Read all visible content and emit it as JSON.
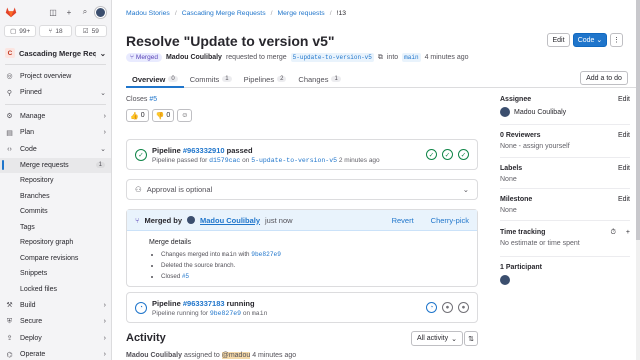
{
  "sidebar": {
    "counts": [
      {
        "icon": "issues-icon",
        "value": "99+"
      },
      {
        "icon": "merge-request-icon",
        "value": "18"
      },
      {
        "icon": "todo-icon",
        "value": "59"
      }
    ],
    "project_initial": "C",
    "project_name": "Cascading Merge Requ...",
    "items": [
      {
        "label": "Project overview",
        "icon": "overview-icon"
      },
      {
        "label": "Pinned",
        "icon": "pin-icon"
      },
      {
        "label": "Manage",
        "icon": "manage-icon"
      },
      {
        "label": "Plan",
        "icon": "plan-icon"
      },
      {
        "label": "Code",
        "icon": "code-icon"
      }
    ],
    "code_sub": [
      {
        "label": "Merge requests",
        "badge": "1"
      },
      {
        "label": "Repository"
      },
      {
        "label": "Branches"
      },
      {
        "label": "Commits"
      },
      {
        "label": "Tags"
      },
      {
        "label": "Repository graph"
      },
      {
        "label": "Compare revisions"
      },
      {
        "label": "Snippets"
      },
      {
        "label": "Locked files"
      }
    ],
    "bottom": [
      {
        "label": "Build",
        "icon": "build-icon"
      },
      {
        "label": "Secure",
        "icon": "secure-icon"
      },
      {
        "label": "Deploy",
        "icon": "deploy-icon"
      },
      {
        "label": "Operate",
        "icon": "operate-icon"
      }
    ]
  },
  "breadcrumbs": [
    "Madou Stories",
    "Cascading Merge Requests",
    "Merge requests",
    "!13"
  ],
  "title": "Resolve \"Update to version v5\"",
  "buttons": {
    "edit": "Edit",
    "code": "Code",
    "add_todo": "Add a to do"
  },
  "meta": {
    "status": "Merged",
    "author": "Madou Coulibaly",
    "requested": "requested to merge",
    "source_branch": "5-update-to-version-v5",
    "into": "into",
    "target_branch": "main",
    "time": "4 minutes ago"
  },
  "tabs": [
    {
      "label": "Overview",
      "count": "0"
    },
    {
      "label": "Commits",
      "count": "1"
    },
    {
      "label": "Pipelines",
      "count": "2"
    },
    {
      "label": "Changes",
      "count": "1"
    }
  ],
  "closes": {
    "prefix": "Closes",
    "link": "#5"
  },
  "reactions": [
    {
      "emoji": "👍",
      "count": "0"
    },
    {
      "emoji": "👎",
      "count": "0"
    }
  ],
  "pipeline1": {
    "label": "Pipeline",
    "id": "#963332910",
    "status": "passed",
    "sub_prefix": "Pipeline passed for",
    "commit": "d1579cac",
    "on": "on",
    "branch": "5-update-to-version-v5",
    "time": "2 minutes ago"
  },
  "approval": {
    "text": "Approval is optional"
  },
  "merged": {
    "label": "Merged by",
    "user": "Madou Coulibaly",
    "time": "just now",
    "revert": "Revert",
    "cherry": "Cherry-pick",
    "details_title": "Merge details",
    "d1_a": "Changes merged into",
    "d1_b": "main",
    "d1_c": "with",
    "d1_commit": "9be827e9",
    "d2": "Deleted the source branch.",
    "d3_a": "Closed",
    "d3_link": "#5"
  },
  "pipeline2": {
    "label": "Pipeline",
    "id": "#963337183",
    "status": "running",
    "sub_prefix": "Pipeline running for",
    "commit": "9be827e9",
    "on": "on",
    "branch": "main"
  },
  "activity": {
    "title": "Activity",
    "filter": "All activity",
    "line_user": "Madou Coulibaly",
    "line_rest": "assigned to",
    "line_mention": "@madou",
    "line_time": "4 minutes ago"
  },
  "side": {
    "assignee_label": "Assignee",
    "assignee_value": "Madou Coulibaly",
    "reviewers_label": "0 Reviewers",
    "reviewers_value": "None - assign yourself",
    "labels_label": "Labels",
    "labels_value": "None",
    "milestone_label": "Milestone",
    "milestone_value": "None",
    "time_label": "Time tracking",
    "time_value": "No estimate or time spent",
    "participants_label": "1 Participant",
    "edit": "Edit"
  },
  "colors": {
    "accent": "#1f75cb",
    "merged": "#5943b6",
    "success": "#108548"
  }
}
